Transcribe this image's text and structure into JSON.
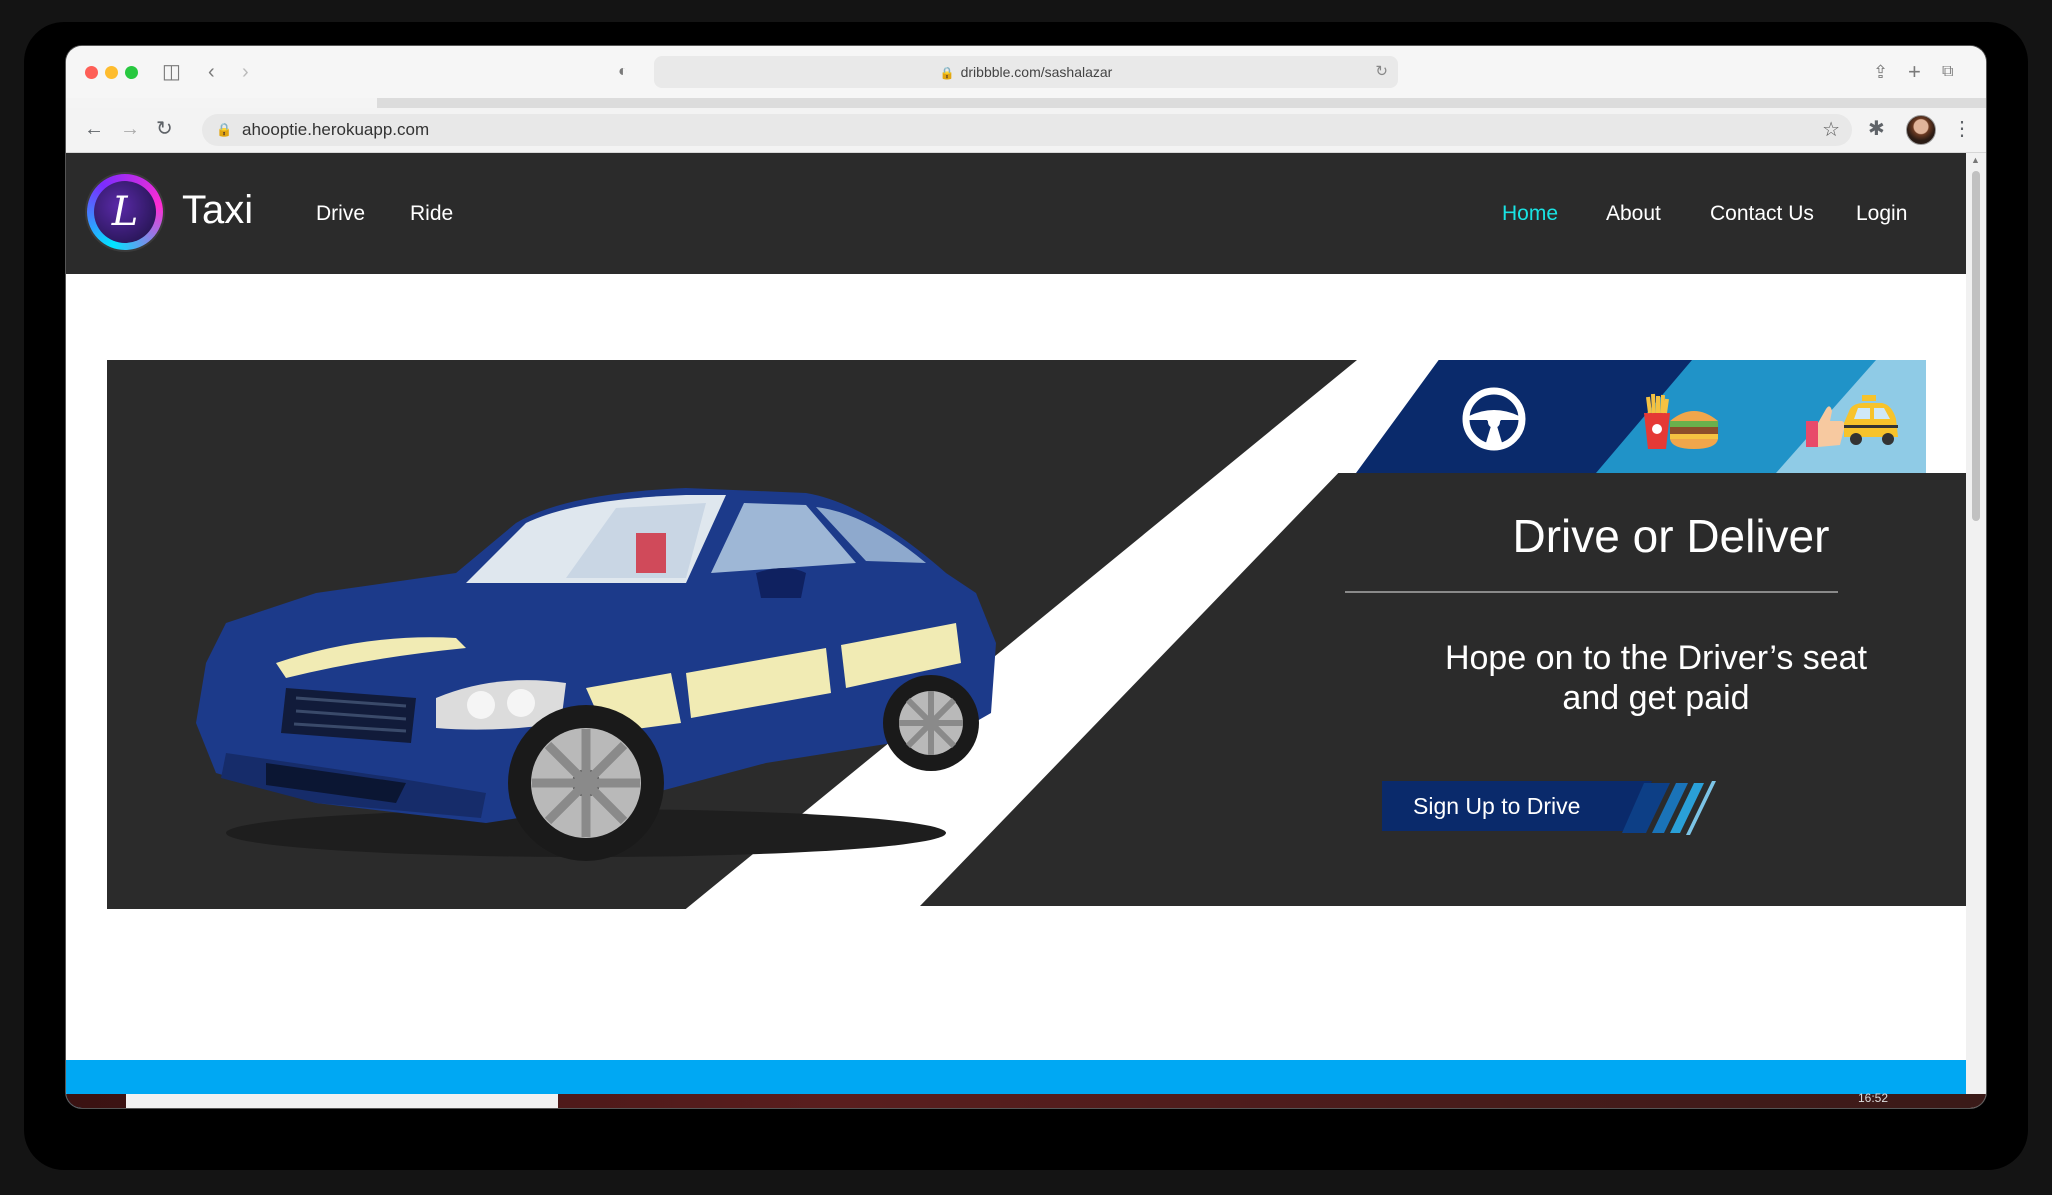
{
  "browser": {
    "outer_url": "dribbble.com/sashalazar",
    "inner_url": "ahooptie.herokuapp.com"
  },
  "site": {
    "logo_letter": "L",
    "brand": "Taxi",
    "nav_left": [
      "Drive",
      "Ride"
    ],
    "nav_right": [
      {
        "label": "Home",
        "active": true
      },
      {
        "label": "About",
        "active": false
      },
      {
        "label": "Contact Us",
        "active": false
      },
      {
        "label": "Login",
        "active": false
      }
    ]
  },
  "hero": {
    "title": "Drive or Deliver",
    "subtitle_line1": "Hope on to the Driver’s seat",
    "subtitle_line2": "and get paid",
    "cta": "Sign Up to Drive",
    "banner_icons": [
      "steering-wheel-icon",
      "food-icon",
      "thumbs-up-taxi-icon"
    ]
  },
  "taskbar": {
    "time": "16:52"
  },
  "colors": {
    "accent": "#19e3e3",
    "panel": "#2b2b2b",
    "navy": "#0a2a6b",
    "section_blue": "#00a8f3"
  }
}
